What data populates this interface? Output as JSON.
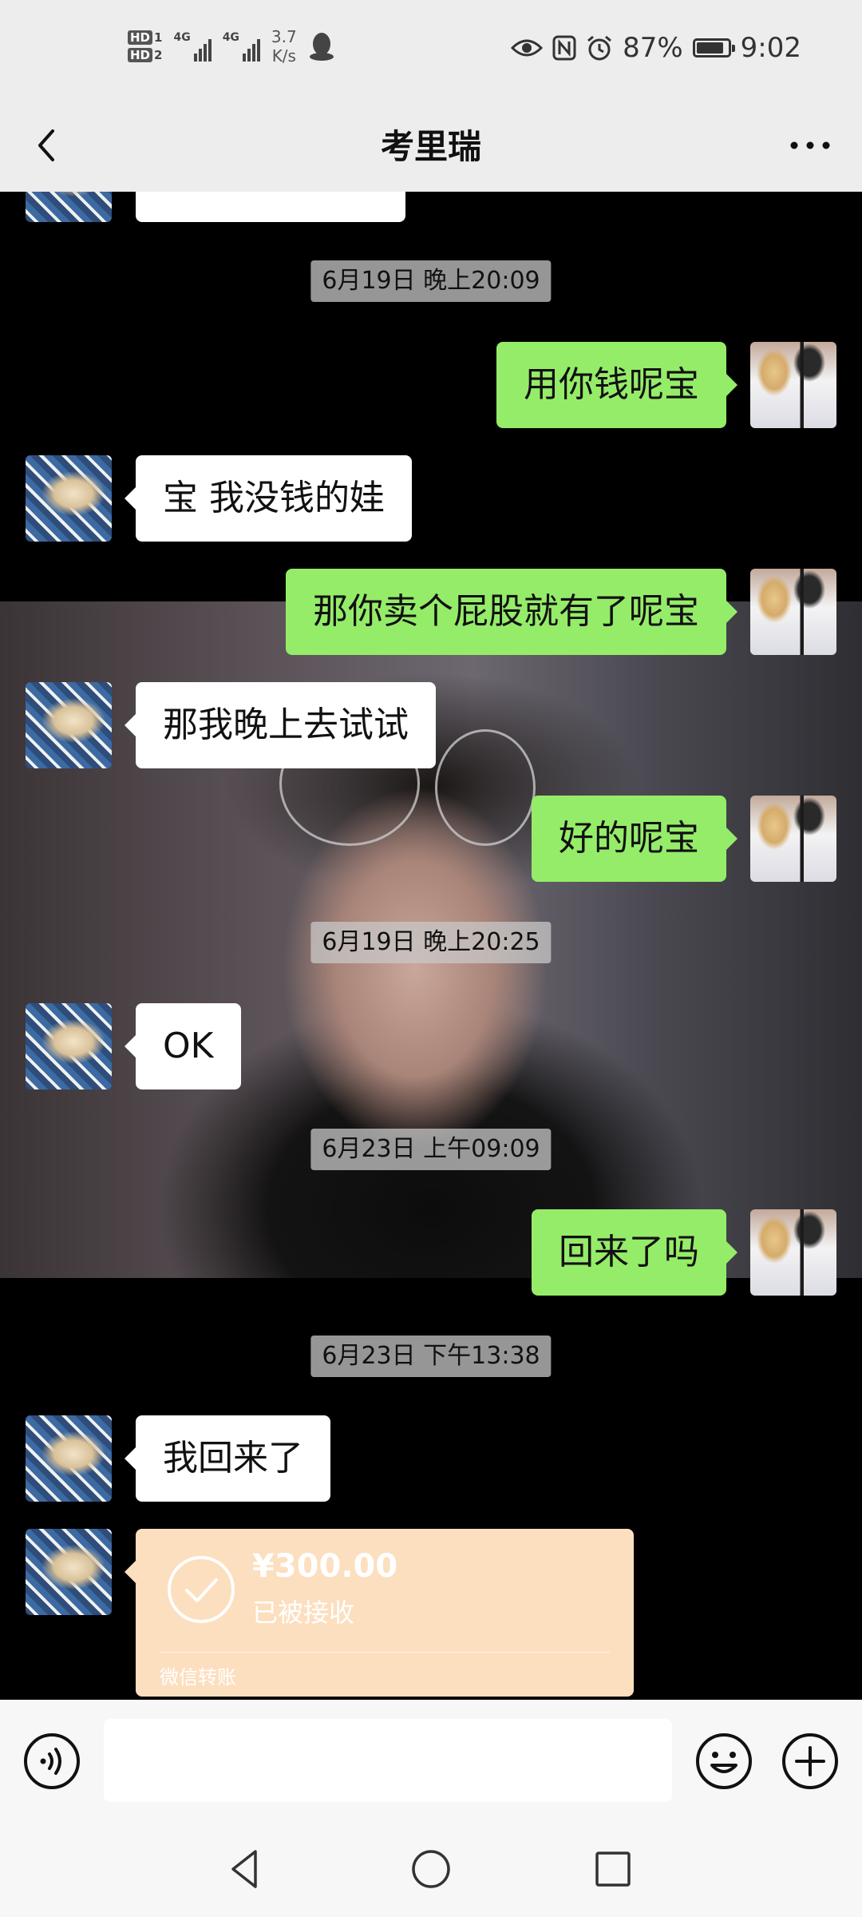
{
  "status_bar": {
    "hd1": "HD",
    "hd1_sim": "1",
    "hd2": "HD",
    "hd2_sim": "2",
    "net1": "4G",
    "net2": "4G",
    "speed_value": "3.7",
    "speed_unit": "K/s",
    "battery_percent": "87%",
    "battery_level": 0.87,
    "time": "9:02",
    "icons": [
      "hd-icon",
      "signal-icon",
      "qq-penguin-icon",
      "eye-icon",
      "nfc-icon",
      "alarm-icon",
      "battery-icon"
    ]
  },
  "header": {
    "title": "考里瑞",
    "back_icon": "chevron-left-icon",
    "more_icon": "more-dots-icon"
  },
  "timestamps": [
    "6月19日 晚上20:09",
    "6月19日 晚上20:25",
    "6月23日 上午09:09",
    "6月23日 下午13:38"
  ],
  "messages": [
    {
      "side": "out",
      "text": "用你钱呢宝"
    },
    {
      "side": "in",
      "text": "宝 我没钱的娃"
    },
    {
      "side": "out",
      "text": "那你卖个屁股就有了呢宝"
    },
    {
      "side": "in",
      "text": "那我晚上去试试"
    },
    {
      "side": "out",
      "text": "好的呢宝"
    },
    {
      "side": "in",
      "text": "OK"
    },
    {
      "side": "out",
      "text": "回来了吗"
    },
    {
      "side": "in",
      "text": "我回来了"
    }
  ],
  "transfer": {
    "amount": "¥300.00",
    "status": "已被接收",
    "label": "微信转账",
    "icon": "check-circle-icon",
    "color": "#fcdfbf"
  },
  "input_bar": {
    "placeholder": "",
    "voice_icon": "voice-icon",
    "emoji_icon": "emoji-icon",
    "plus_icon": "plus-icon"
  },
  "nav": [
    "back-triangle-icon",
    "home-circle-icon",
    "recents-square-icon"
  ],
  "colors": {
    "outgoing_bubble": "#95ec69",
    "incoming_bubble": "#ffffff",
    "chat_background": "#000000",
    "header_bg": "#ededed"
  }
}
